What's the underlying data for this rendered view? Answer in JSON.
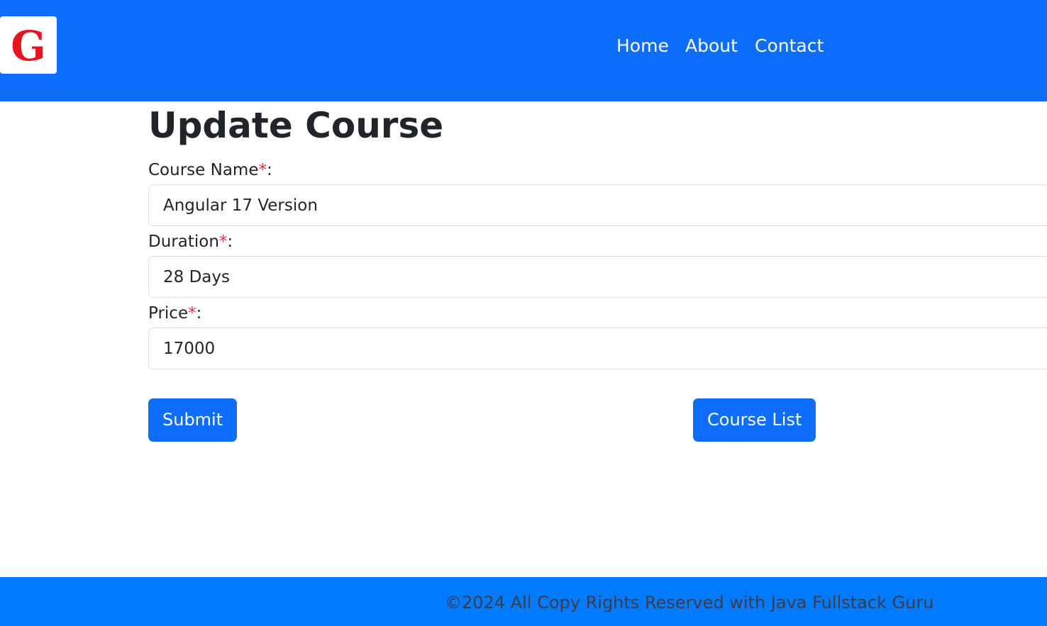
{
  "brand": {
    "logo_letter": "G",
    "logo_color": "#e8141b",
    "nav_color": "#0d6efd"
  },
  "nav": {
    "items": [
      {
        "label": "Home"
      },
      {
        "label": "About"
      },
      {
        "label": "Contact"
      }
    ]
  },
  "form": {
    "title": "Update Course",
    "required_mark": "*",
    "label_suffix": ":",
    "fields": [
      {
        "label": "Course Name",
        "value": "Angular 17 Version"
      },
      {
        "label": "Duration",
        "value": "28 Days"
      },
      {
        "label": "Price",
        "value": "17000"
      }
    ],
    "submit_label": "Submit",
    "course_list_label": "Course List"
  },
  "footer": {
    "text": "©2024 All Copy Rights Reserved with Java Fullstack Guru",
    "background": "#007bff"
  }
}
